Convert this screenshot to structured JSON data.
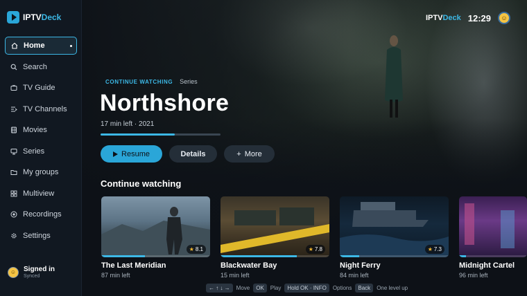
{
  "brand": {
    "name_a": "IPTV",
    "name_b": "Deck"
  },
  "sidebar": {
    "items": [
      {
        "label": "Home",
        "icon": "home-icon",
        "active": true
      },
      {
        "label": "Search",
        "icon": "search-icon"
      },
      {
        "label": "TV Guide",
        "icon": "tv-icon"
      },
      {
        "label": "TV Channels",
        "icon": "channels-icon"
      },
      {
        "label": "Movies",
        "icon": "film-icon"
      },
      {
        "label": "Series",
        "icon": "series-icon"
      },
      {
        "label": "My groups",
        "icon": "folder-icon"
      },
      {
        "label": "Multiview",
        "icon": "grid-icon"
      },
      {
        "label": "Recordings",
        "icon": "record-icon"
      },
      {
        "label": "Settings",
        "icon": "gear-icon"
      }
    ],
    "account": {
      "title": "Signed in",
      "subtitle": "Synced"
    }
  },
  "topbar": {
    "brand_a": "IPTV",
    "brand_b": "Deck",
    "clock": "12:29"
  },
  "hero": {
    "eyebrow": "CONTINUE WATCHING",
    "kind": "Series",
    "title": "Northshore",
    "meta": "17 min left · 2021",
    "progress": 0.62,
    "buttons": {
      "resume": "Resume",
      "details": "Details",
      "more": "More",
      "more_prefix": "+"
    }
  },
  "continue_watching": {
    "title": "Continue watching",
    "items": [
      {
        "title": "The Last Meridian",
        "sub": "87 min left",
        "rating": "8.1",
        "progress": 0.4
      },
      {
        "title": "Blackwater Bay",
        "sub": "15 min left",
        "rating": "7.8",
        "progress": 0.7
      },
      {
        "title": "Night Ferry",
        "sub": "84 min left",
        "rating": "7.3",
        "progress": 0.18
      },
      {
        "title": "Midnight Cartel",
        "sub": "96 min left",
        "rating": "",
        "progress": 0.1
      }
    ]
  },
  "hints": {
    "arrows": "← ↑ ↓ →",
    "move": "Move",
    "ok": "OK",
    "play": "Play",
    "hold": "Hold OK · INFO",
    "options": "Options",
    "back": "Back",
    "level_up": "One level up"
  },
  "colors": {
    "accent": "#3cb8e6",
    "primary_button": "#2aa6d8",
    "background": "#0d1117"
  }
}
